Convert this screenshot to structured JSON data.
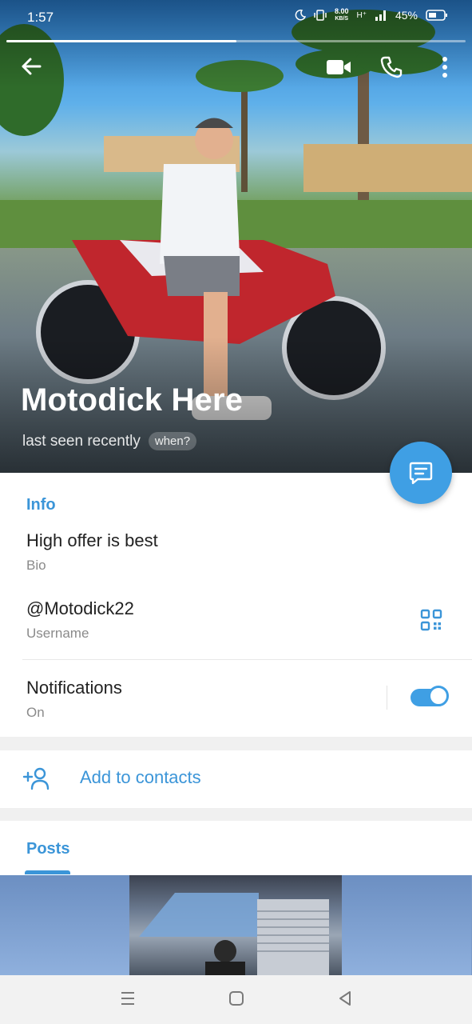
{
  "statusbar": {
    "time": "1:57",
    "net_speed_value": "8.00",
    "net_speed_unit": "KB/S",
    "signal_label": "H⁺",
    "battery": "45%"
  },
  "story_progress": {
    "segments": 2,
    "current": 1,
    "fill_fraction": 0.5
  },
  "icons": {
    "back": "back-arrow-icon",
    "video": "video-call-icon",
    "call": "phone-icon",
    "more": "more-vertical-icon",
    "message": "message-icon",
    "qr": "qr-code-icon",
    "add_contact": "add-user-icon"
  },
  "profile": {
    "name": "Motodick Here",
    "last_seen": "last seen recently",
    "when_label": "when?"
  },
  "info": {
    "title": "Info",
    "bio_value": "High offer is best",
    "bio_label": "Bio",
    "username_value": "@Motodick22",
    "username_label": "Username",
    "notifications_value": "Notifications",
    "notifications_state": "On",
    "notifications_enabled": true
  },
  "actions": {
    "add_to_contacts": "Add to contacts"
  },
  "posts": {
    "tab_label": "Posts"
  },
  "colors": {
    "accent": "#3b95d8",
    "fab": "#3f9fe4",
    "divider": "#e8e8e8",
    "muted_text": "#8a8a8a"
  }
}
